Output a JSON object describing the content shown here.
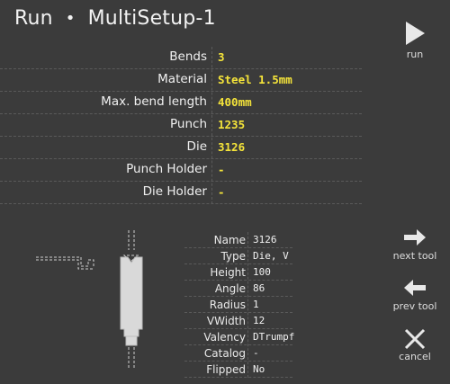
{
  "header": {
    "run_label": "Run",
    "separator": "•",
    "setup_name": "MultiSetup-1"
  },
  "setup": [
    {
      "label": "Bends",
      "value": "3"
    },
    {
      "label": "Material",
      "value": "Steel 1.5mm"
    },
    {
      "label": "Max. bend length",
      "value": "400mm"
    },
    {
      "label": "Punch",
      "value": "1235"
    },
    {
      "label": "Die",
      "value": "3126"
    },
    {
      "label": "Punch Holder",
      "value": "-"
    },
    {
      "label": "Die Holder",
      "value": "-"
    }
  ],
  "tool": [
    {
      "label": "Name",
      "value": "3126"
    },
    {
      "label": "Type",
      "value": "Die, V"
    },
    {
      "label": "Height",
      "value": "100"
    },
    {
      "label": "Angle",
      "value": "86"
    },
    {
      "label": "Radius",
      "value": "1"
    },
    {
      "label": "VWidth",
      "value": "12"
    },
    {
      "label": "Valency",
      "value": "DTrumpf"
    },
    {
      "label": "Catalog",
      "value": "-"
    },
    {
      "label": "Flipped",
      "value": "No"
    }
  ],
  "buttons": {
    "run": "run",
    "next_tool": "next tool",
    "prev_tool": "prev tool",
    "cancel": "cancel"
  },
  "icons": {
    "run": "play-icon",
    "next": "arrow-right-icon",
    "prev": "arrow-left-icon",
    "cancel": "close-icon"
  },
  "colors": {
    "background": "#3b3b3b",
    "value_highlight": "#f5e43a",
    "text": "#eaeaea"
  }
}
